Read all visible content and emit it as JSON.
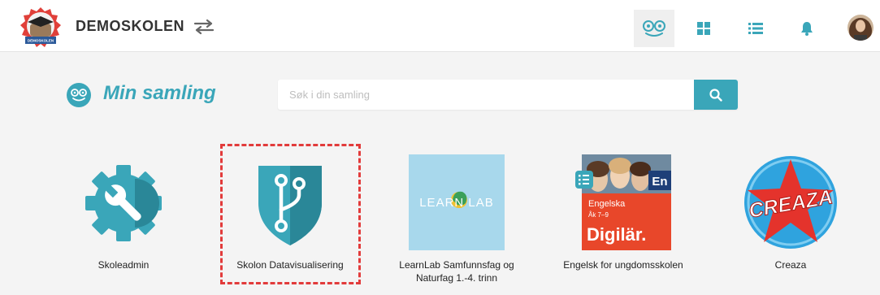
{
  "header": {
    "school_name": "DEMOSKOLEN",
    "logo_text": "DEMOSKOLEN",
    "icons": [
      "switch-icon",
      "collection-icon",
      "grid-icon",
      "list-icon",
      "bell-icon"
    ]
  },
  "main": {
    "title": "Min samling",
    "search": {
      "placeholder": "Søk i din samling",
      "value": ""
    }
  },
  "apps": [
    {
      "name": "Skoleadmin",
      "icon": "gear-wrench-icon"
    },
    {
      "name": "Skolon Datavisualisering",
      "icon": "shield-branch-icon",
      "highlighted": true
    },
    {
      "name": "LearnLab Samfunnsfag og Naturfag 1.-4. trinn",
      "icon": "learnlab-logo",
      "logo_text": "LEARN LAB"
    },
    {
      "name": "Engelsk for ungdomsskolen",
      "icon": "digilar-book-cover",
      "cover_badge": "En",
      "cover_title": "Engelska",
      "cover_grade": "Åk 7–9",
      "cover_brand": "Digilär."
    },
    {
      "name": "Creaza",
      "icon": "creaza-logo",
      "logo_text": "CREAZA"
    }
  ],
  "colors": {
    "accent": "#3aa6b9",
    "highlight": "#e23b3b",
    "logo_red": "#e0403a"
  }
}
